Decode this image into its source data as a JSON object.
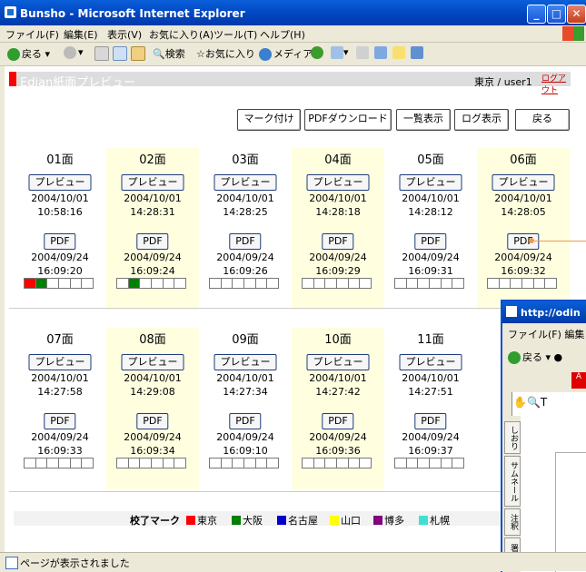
{
  "window": {
    "title": "Bunsho - Microsoft Internet Explorer"
  },
  "menu": [
    "ファイル(F)",
    "編集(E)",
    "表示(V)",
    "お気に入り(A)",
    "ツール(T)",
    "ヘルプ(H)"
  ],
  "toolbar": {
    "back": "戻る",
    "search": "検索",
    "favorites": "お気に入り",
    "media": "メディア"
  },
  "app": {
    "title": "Edian紙面プレビュー",
    "user": "東京 / user1",
    "logout": "ログアウト"
  },
  "actions": [
    "マーク付け",
    "PDFダウンロード",
    "一覧表示",
    "ログ表示",
    "戻る"
  ],
  "pages_row1": [
    {
      "name": "01面",
      "preview_label": "プレビュー",
      "preview_date": "2004/10/01",
      "preview_time": "10:58:16",
      "pdf_label": "PDF",
      "pdf_date": "2004/09/24",
      "pdf_time": "16:09:20",
      "marks": [
        "#ff0000",
        "#008000",
        "",
        "",
        "",
        ""
      ]
    },
    {
      "name": "02面",
      "preview_label": "プレビュー",
      "preview_date": "2004/10/01",
      "preview_time": "14:28:31",
      "pdf_label": "PDF",
      "pdf_date": "2004/09/24",
      "pdf_time": "16:09:24",
      "marks": [
        "",
        "#008000",
        "",
        "",
        "",
        ""
      ]
    },
    {
      "name": "03面",
      "preview_label": "プレビュー",
      "preview_date": "2004/10/01",
      "preview_time": "14:28:25",
      "pdf_label": "PDF",
      "pdf_date": "2004/09/24",
      "pdf_time": "16:09:26",
      "marks": [
        "",
        "",
        "",
        "",
        "",
        ""
      ]
    },
    {
      "name": "04面",
      "preview_label": "プレビュー",
      "preview_date": "2004/10/01",
      "preview_time": "14:28:18",
      "pdf_label": "PDF",
      "pdf_date": "2004/09/24",
      "pdf_time": "16:09:29",
      "marks": [
        "",
        "",
        "",
        "",
        "",
        ""
      ]
    },
    {
      "name": "05面",
      "preview_label": "プレビュー",
      "preview_date": "2004/10/01",
      "preview_time": "14:28:12",
      "pdf_label": "PDF",
      "pdf_date": "2004/09/24",
      "pdf_time": "16:09:31",
      "marks": [
        "",
        "",
        "",
        "",
        "",
        ""
      ]
    },
    {
      "name": "06面",
      "preview_label": "プレビュー",
      "preview_date": "2004/10/01",
      "preview_time": "14:28:05",
      "pdf_label": "PDF",
      "pdf_date": "2004/09/24",
      "pdf_time": "16:09:32",
      "marks": [
        "",
        "",
        "",
        "",
        "",
        ""
      ]
    }
  ],
  "pages_row2": [
    {
      "name": "07面",
      "preview_label": "プレビュー",
      "preview_date": "2004/10/01",
      "preview_time": "14:27:58",
      "pdf_label": "PDF",
      "pdf_date": "2004/09/24",
      "pdf_time": "16:09:33",
      "marks": [
        "",
        "",
        "",
        "",
        "",
        ""
      ]
    },
    {
      "name": "08面",
      "preview_label": "プレビュー",
      "preview_date": "2004/10/01",
      "preview_time": "14:29:08",
      "pdf_label": "PDF",
      "pdf_date": "2004/09/24",
      "pdf_time": "16:09:34",
      "marks": [
        "",
        "",
        "",
        "",
        "",
        ""
      ]
    },
    {
      "name": "09面",
      "preview_label": "プレビュー",
      "preview_date": "2004/10/01",
      "preview_time": "14:27:34",
      "pdf_label": "PDF",
      "pdf_date": "2004/09/24",
      "pdf_time": "16:09:10",
      "marks": [
        "",
        "",
        "",
        "",
        "",
        ""
      ]
    },
    {
      "name": "10面",
      "preview_label": "プレビュー",
      "preview_date": "2004/10/01",
      "preview_time": "14:27:42",
      "pdf_label": "PDF",
      "pdf_date": "2004/09/24",
      "pdf_time": "16:09:36",
      "marks": [
        "",
        "",
        "",
        "",
        "",
        ""
      ]
    },
    {
      "name": "11面",
      "preview_label": "プレビュー",
      "preview_date": "2004/10/01",
      "preview_time": "14:27:51",
      "pdf_label": "PDF",
      "pdf_date": "2004/09/24",
      "pdf_time": "16:09:37",
      "marks": [
        "",
        "",
        "",
        "",
        "",
        ""
      ]
    }
  ],
  "legend": {
    "title": "校了マーク",
    "items": [
      {
        "label": "東京",
        "color": "#ff0000"
      },
      {
        "label": "大阪",
        "color": "#008000"
      },
      {
        "label": "名古屋",
        "color": "#0000cc"
      },
      {
        "label": "山口",
        "color": "#ffff00"
      },
      {
        "label": "博多",
        "color": "#800080"
      },
      {
        "label": "札幌",
        "color": "#40e0d0"
      }
    ]
  },
  "status": {
    "text": "ページが表示されました"
  },
  "popup": {
    "title": "http://odin",
    "menu": "ファイル(F)  編集",
    "back": "戻る",
    "tabs": [
      "しおり",
      "サムネール",
      "注釈",
      "署名"
    ]
  }
}
